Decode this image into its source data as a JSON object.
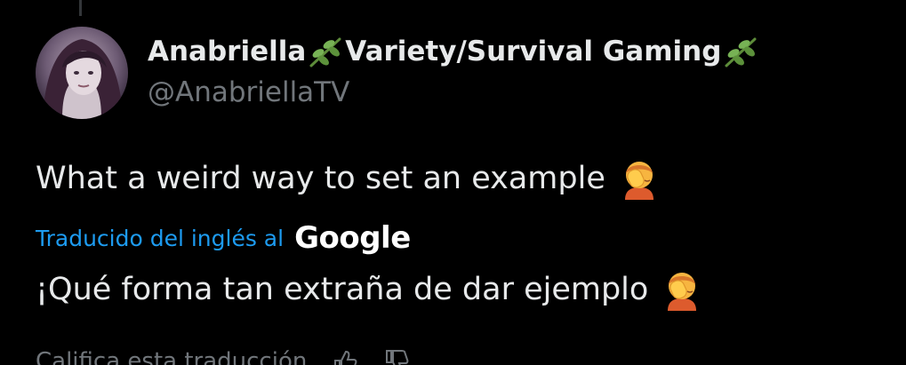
{
  "author": {
    "display_name_part1": "Anabriella",
    "display_name_part2": "Variety/Survival Gaming",
    "handle": "@AnabriellaTV"
  },
  "tweet": {
    "text": "What a weird way to set an example",
    "emoji": "face-palm"
  },
  "translation": {
    "label": "Traducido del inglés al",
    "provider": "Google",
    "text": "¡Qué forma tan extraña de dar ejemplo"
  },
  "rating": {
    "label": "Califica esta traducción"
  },
  "colors": {
    "background": "#000000",
    "text_primary": "#e7e9ea",
    "text_secondary": "#71767b",
    "link_blue": "#1d9bf0"
  }
}
